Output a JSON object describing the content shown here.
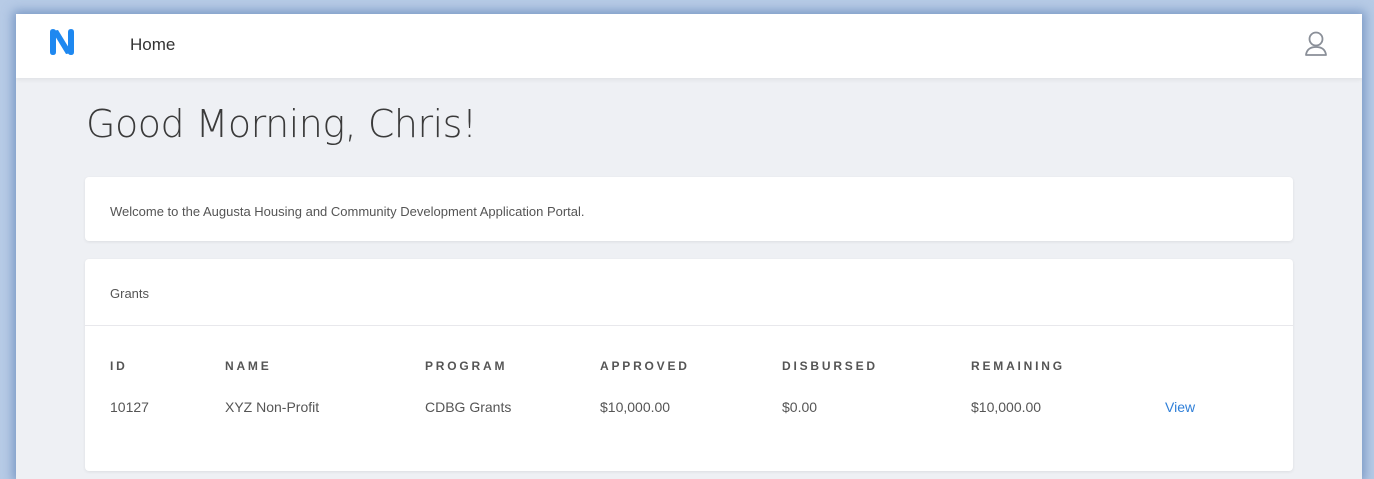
{
  "nav": {
    "home_label": "Home"
  },
  "icons": {
    "logo": "n-logo-icon",
    "user": "user-icon"
  },
  "colors": {
    "logo_blue": "#1e88f0",
    "link_blue": "#2f7fd8"
  },
  "greeting": "Good Morning, Chris!",
  "welcome": {
    "text": "Welcome to the Augusta Housing and Community Development Application Portal."
  },
  "grants": {
    "title": "Grants",
    "columns": [
      "ID",
      "NAME",
      "PROGRAM",
      "APPROVED",
      "DISBURSED",
      "REMAINING"
    ],
    "rows": [
      {
        "id": "10127",
        "name": "XYZ Non-Profit",
        "program": "CDBG Grants",
        "approved": "$10,000.00",
        "disbursed": "$0.00",
        "remaining": "$10,000.00",
        "action": "View"
      }
    ]
  }
}
